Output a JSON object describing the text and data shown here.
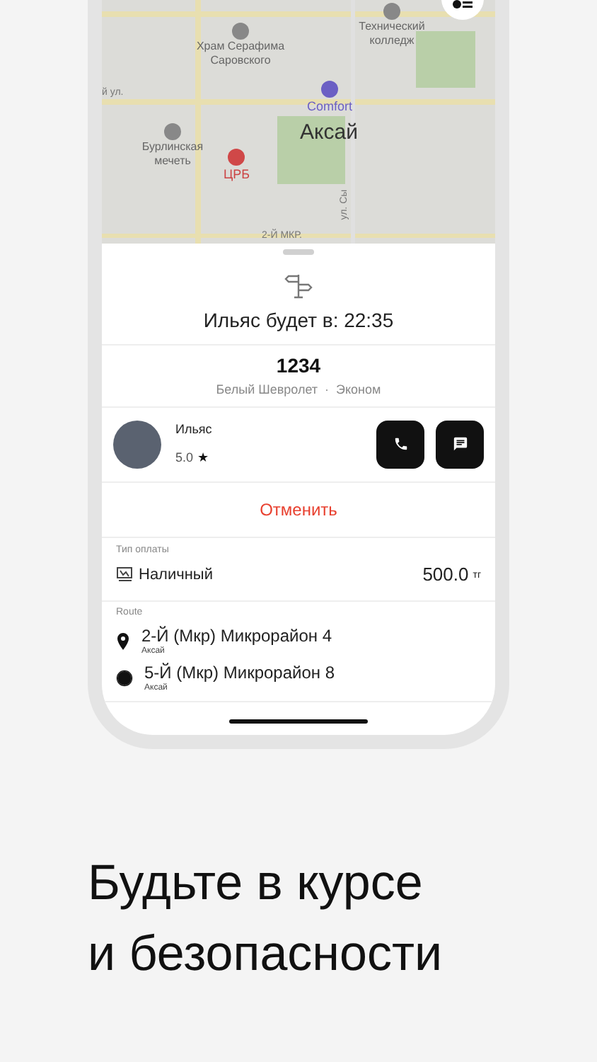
{
  "map": {
    "labels": [
      {
        "text": "Храм Серафима Саровского",
        "kind": "poi"
      },
      {
        "text": "Технический колледж",
        "kind": "poi"
      },
      {
        "text": "Comfort",
        "kind": "hotel"
      },
      {
        "text": "й ул.",
        "kind": "street"
      },
      {
        "text": "Бурлинская мечеть",
        "kind": "poi"
      },
      {
        "text": "ЦРБ",
        "kind": "hospital"
      },
      {
        "text": "Аксай",
        "kind": "district"
      },
      {
        "text": "2-Й МКР.",
        "kind": "street"
      },
      {
        "text": "ул. Сы",
        "kind": "street"
      }
    ]
  },
  "arrival": "Ильяс будет в: 22:35",
  "car": {
    "plate": "1234",
    "model": "Белый Шевролет",
    "separator": "·",
    "tariff": "Эконом"
  },
  "driver": {
    "name": "Ильяс",
    "rating": "5.0",
    "star": "★"
  },
  "cancel": "Отменить",
  "payment": {
    "label": "Тип оплаты",
    "method": "Наличный",
    "amount": "500.0",
    "currency": "тг"
  },
  "route": {
    "label": "Route",
    "stops": [
      {
        "kind": "start",
        "address": "2-Й (Мкр) Микрорайон 4",
        "city": "Аксай"
      },
      {
        "kind": "end",
        "address": "5-Й (Мкр) Микрорайон 8",
        "city": "Аксай"
      }
    ]
  },
  "headline": [
    "Будьте в курсе",
    "и безопасности"
  ]
}
